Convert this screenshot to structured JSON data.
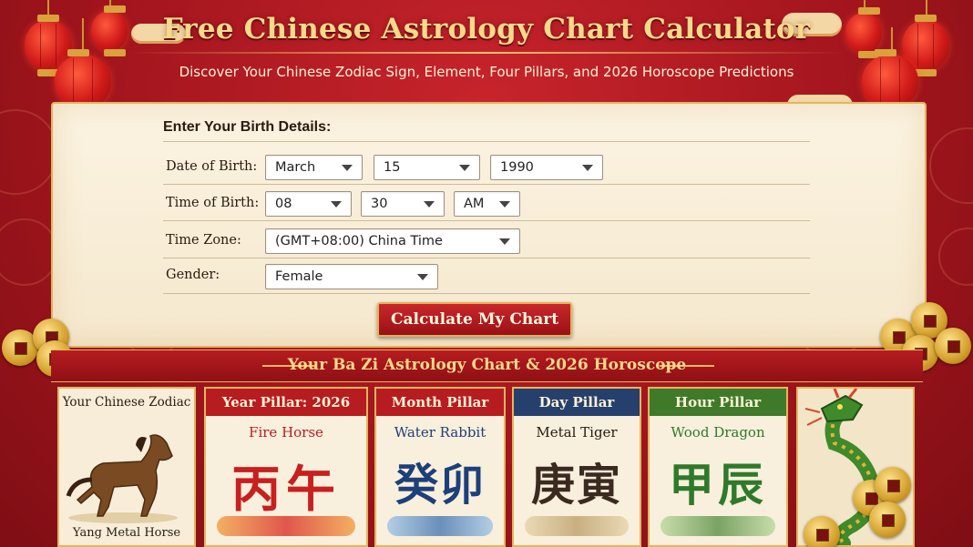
{
  "header": {
    "title": "Free Chinese Astrology Chart Calculator",
    "subtitle": "Discover Your Chinese Zodiac Sign, Element, Four Pillars, and 2026 Horoscope Predictions"
  },
  "form": {
    "heading": "Enter Your Birth Details:",
    "dob_label": "Date of Birth:",
    "dob_month": "March",
    "dob_day": "15",
    "dob_year": "1990",
    "tob_label": "Time of Birth:",
    "tob_hour": "08",
    "tob_minute": "30",
    "tob_ampm": "AM",
    "tz_label": "Time Zone:",
    "tz_value": "(GMT+08:00) China Time",
    "gender_label": "Gender:",
    "gender_value": "Female",
    "submit_label": "Calculate My Chart"
  },
  "results": {
    "banner": "Your Ba Zi Astrology Chart & 2026 Horoscope",
    "zodiac": {
      "title": "Your Chinese Zodiac",
      "caption": "Yang Metal Horse"
    },
    "pillars": [
      {
        "title": "Year Pillar: 2026",
        "name": "Fire Horse",
        "hanzi": "丙午",
        "color": "#c81f1f"
      },
      {
        "title": "Month Pillar",
        "name": "Water Rabbit",
        "hanzi": "癸卯",
        "color": "#1d3f7a"
      },
      {
        "title": "Day Pillar",
        "name": "Metal Tiger",
        "hanzi": "庚寅",
        "color": "#3a2a1f"
      },
      {
        "title": "Hour Pillar",
        "name": "Wood Dragon",
        "hanzi": "甲辰",
        "color": "#2f7a2a"
      }
    ]
  },
  "icons": {
    "lantern": "lantern-icon",
    "coin": "coin-icon",
    "horse": "horse-icon",
    "dragon": "dragon-icon",
    "cloud": "cloud-icon"
  },
  "colors": {
    "background_red": "#a3151d",
    "gold": "#f7d98a",
    "panel": "#fbf3e2",
    "year_head": "#b71c20",
    "month_head": "#b71c20",
    "day_head": "#26406e",
    "hour_head": "#3f7a2b"
  }
}
